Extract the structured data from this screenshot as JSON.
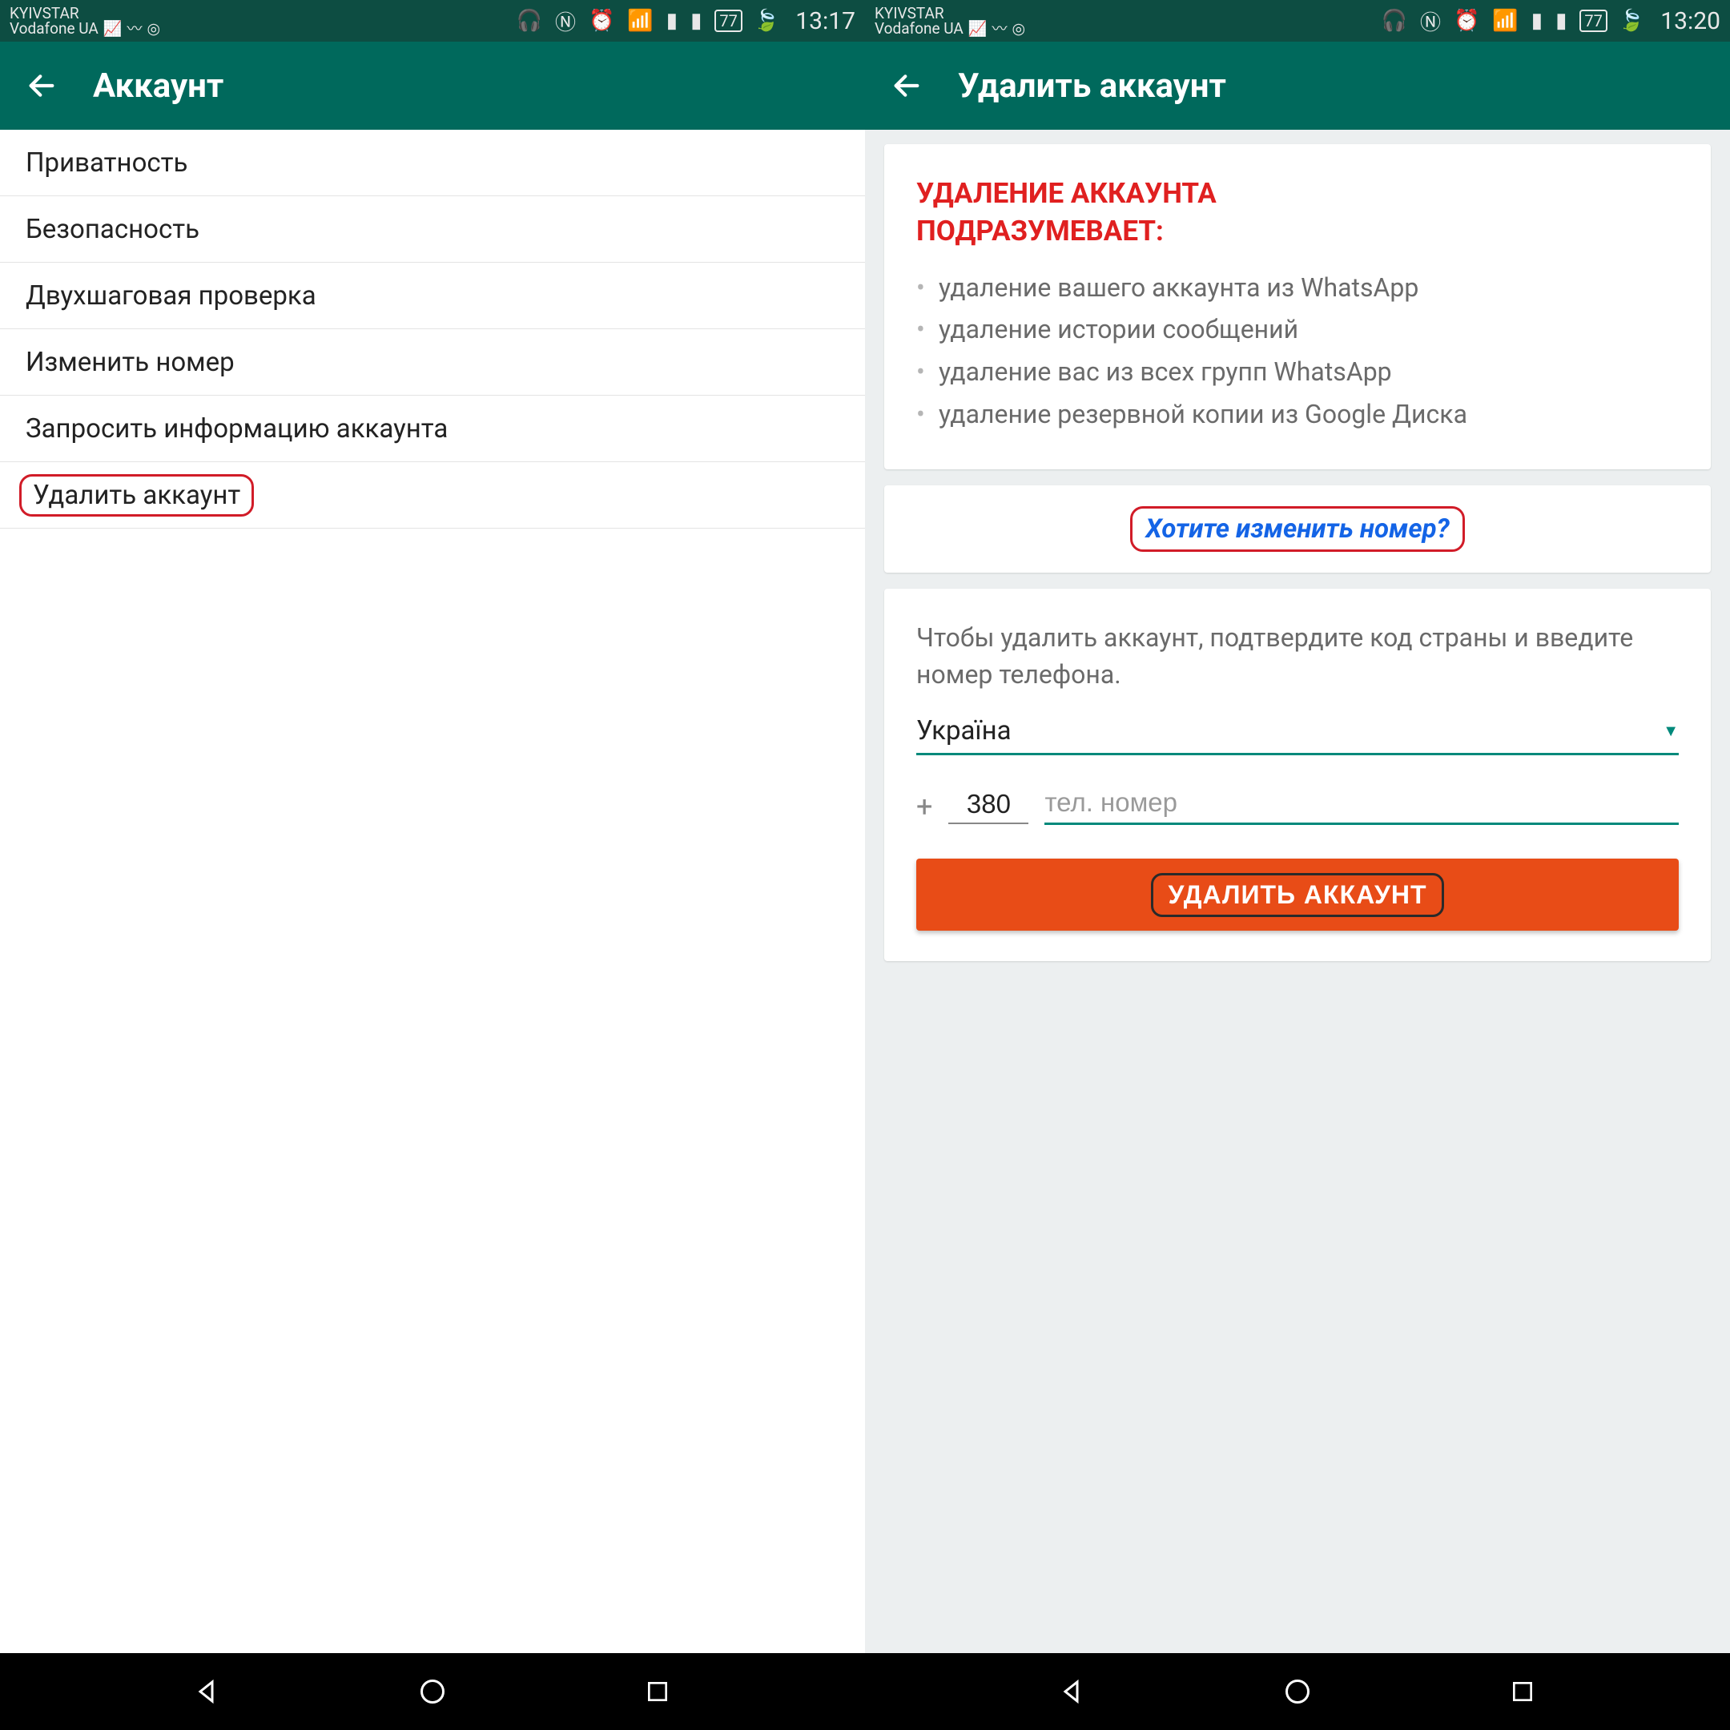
{
  "status": {
    "carrier1": "KYIVSTAR",
    "carrier2": "Vodafone UA",
    "battery": "77",
    "time_left": "13:17",
    "time_right": "13:20"
  },
  "left": {
    "title": "Аккаунт",
    "items": [
      "Приватность",
      "Безопасность",
      "Двухшаговая проверка",
      "Изменить номер",
      "Запросить информацию аккаунта",
      "Удалить аккаунт"
    ]
  },
  "right": {
    "title": "Удалить аккаунт",
    "warning_title_l1": "УДАЛЕНИЕ АККАУНТА",
    "warning_title_l2": "ПОДРАЗУМЕВАЕТ:",
    "bullets": [
      "удаление вашего аккаунта из WhatsApp",
      "удаление истории сообщений",
      "удаление вас из всех групп WhatsApp",
      "удаление резервной копии из Google Диска"
    ],
    "change_number": "Хотите изменить номер?",
    "confirm_text": "Чтобы удалить аккаунт, подтвердите код страны и введите номер телефона.",
    "country": "Україна",
    "plus": "+",
    "country_code": "380",
    "phone_placeholder": "тел. номер",
    "delete_button": "УДАЛИТЬ АККАУНТ"
  }
}
